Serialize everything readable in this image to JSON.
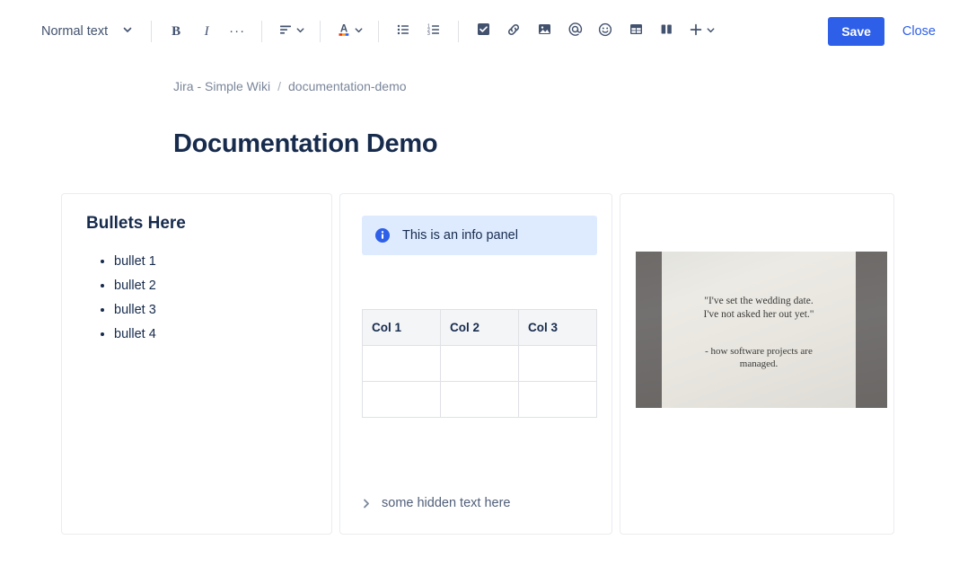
{
  "toolbar": {
    "style_select": {
      "label": "Normal text",
      "icon": "chevron-down-icon"
    },
    "bold_label": "B",
    "italic_label": "I",
    "more_formatting_label": "···",
    "items": [
      {
        "name": "text-align-button",
        "icon": "text-align-icon"
      },
      {
        "name": "text-color-button",
        "icon": "text-color-a-icon"
      },
      {
        "name": "bullet-list-button",
        "icon": "bullet-list-icon"
      },
      {
        "name": "numbered-list-button",
        "icon": "numbered-list-icon"
      },
      {
        "name": "action-item-button",
        "icon": "checkbox-icon"
      },
      {
        "name": "link-button",
        "icon": "link-icon"
      },
      {
        "name": "image-button",
        "icon": "image-icon"
      },
      {
        "name": "mention-button",
        "icon": "mention-at-icon"
      },
      {
        "name": "emoji-button",
        "icon": "emoji-smiley-icon"
      },
      {
        "name": "table-button",
        "icon": "table-icon"
      },
      {
        "name": "layout-button",
        "icon": "columns-layout-icon"
      },
      {
        "name": "insert-more-button",
        "icon": "plus-icon"
      }
    ],
    "save_label": "Save",
    "close_label": "Close"
  },
  "colors": {
    "accent": "#2E5FE8",
    "text": "#172B4D",
    "muted": "#7A869A",
    "panel_border": "#EBECF0",
    "info_bg": "#DEEBFF",
    "table_header_bg": "#F4F5F7"
  },
  "breadcrumb": {
    "space": "Jira - Simple Wiki",
    "separator": "/",
    "page": "documentation-demo"
  },
  "page": {
    "title": "Documentation Demo"
  },
  "columns": {
    "left": {
      "heading": "Bullets Here",
      "bullets": [
        "bullet 1",
        "bullet 2",
        "bullet 3",
        "bullet 4"
      ]
    },
    "middle": {
      "info_panel": {
        "icon": "info-circle-icon",
        "text": "This is an info panel"
      },
      "table": {
        "headers": [
          "Col 1",
          "Col 2",
          "Col 3"
        ],
        "rows": [
          [
            "",
            "",
            ""
          ],
          [
            "",
            "",
            ""
          ]
        ]
      },
      "expand": {
        "icon": "chevron-right-icon",
        "label": "some hidden text here"
      }
    },
    "right": {
      "image": {
        "name": "quote-photo",
        "quote": "\"I've set the wedding date.\nI've not asked her out yet.\"",
        "quote_line1": "\"I've set the wedding date.",
        "quote_line2": "I've not asked her out yet.\"",
        "attribution_line1": "- how software projects are",
        "attribution_line2": "managed."
      }
    }
  }
}
